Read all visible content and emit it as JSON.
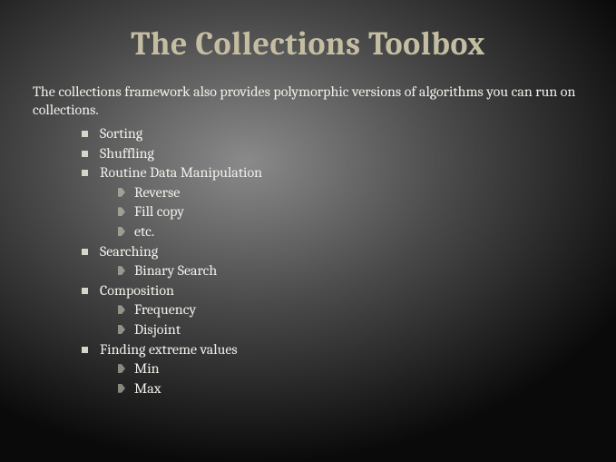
{
  "title": "The Collections Toolbox",
  "intro": "The collections framework also provides polymorphic versions of algorithms you can run on collections.",
  "items": [
    {
      "label": "Sorting"
    },
    {
      "label": "Shuffling"
    },
    {
      "label": "Routine Data Manipulation",
      "sub": [
        "Reverse",
        "Fill copy",
        "etc."
      ]
    },
    {
      "label": "Searching",
      "sub": [
        "Binary Search"
      ]
    },
    {
      "label": "Composition",
      "sub": [
        "Frequency",
        "Disjoint"
      ]
    },
    {
      "label": "Finding extreme values",
      "sub": [
        "Min",
        "Max"
      ]
    }
  ]
}
